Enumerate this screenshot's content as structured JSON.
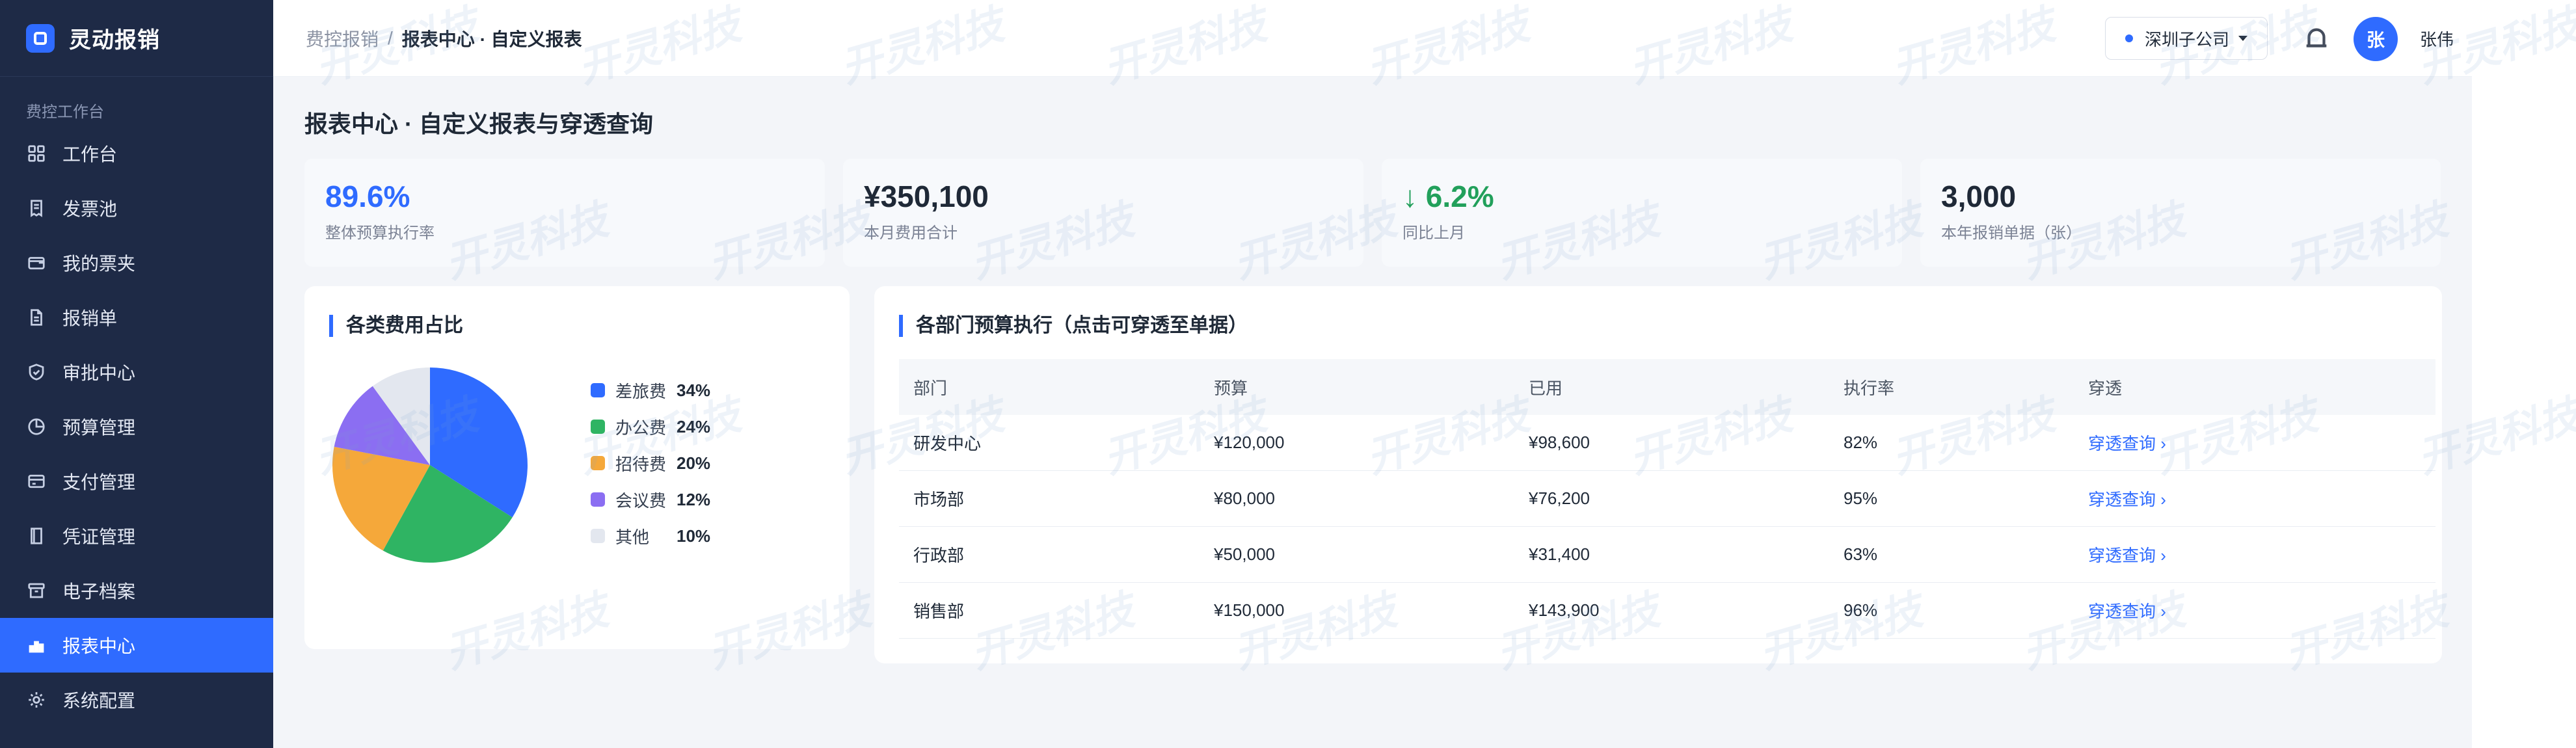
{
  "app": {
    "name": "灵动报销"
  },
  "sidebar": {
    "section_title": "费控工作台",
    "items": [
      {
        "label": "工作台",
        "icon": "grid-icon"
      },
      {
        "label": "发票池",
        "icon": "receipt-icon"
      },
      {
        "label": "我的票夹",
        "icon": "wallet-icon"
      },
      {
        "label": "报销单",
        "icon": "document-icon"
      },
      {
        "label": "审批中心",
        "icon": "shield-check-icon"
      },
      {
        "label": "预算管理",
        "icon": "pie-clock-icon"
      },
      {
        "label": "支付管理",
        "icon": "card-icon"
      },
      {
        "label": "凭证管理",
        "icon": "book-icon"
      },
      {
        "label": "电子档案",
        "icon": "archive-icon"
      },
      {
        "label": "报表中心",
        "icon": "bar-chart-icon",
        "active": true
      },
      {
        "label": "系统配置",
        "icon": "gear-icon"
      }
    ]
  },
  "header": {
    "breadcrumb_root": "费控报销",
    "breadcrumb_sep": "/",
    "breadcrumb_current": "报表中心 · 自定义报表",
    "company": "深圳子公司",
    "avatar_text": "张",
    "user_name": "张伟"
  },
  "page": {
    "title": "报表中心 · 自定义报表与穿透查询"
  },
  "stats": [
    {
      "value": "89.6%",
      "label": "整体预算执行率"
    },
    {
      "value": "¥350,100",
      "label": "本月费用合计"
    },
    {
      "value": "↓ 6.2%",
      "label": "同比上月"
    },
    {
      "value": "3,000",
      "label": "本年报销单据（张）"
    }
  ],
  "pie_panel": {
    "title": "各类费用占比"
  },
  "chart_data": {
    "type": "pie",
    "categories": [
      "差旅费",
      "办公费",
      "招待费",
      "会议费",
      "其他"
    ],
    "values": [
      34,
      24,
      20,
      12,
      10
    ],
    "value_labels": [
      "34%",
      "24%",
      "20%",
      "12%",
      "10%"
    ],
    "colors": [
      "#2f6bff",
      "#2fb463",
      "#f5a83a",
      "#8b6ef2",
      "#e3e7ef"
    ]
  },
  "table_panel": {
    "title": "各部门预算执行（点击可穿透至单据）",
    "columns": [
      "部门",
      "预算",
      "已用",
      "执行率",
      "穿透"
    ],
    "rows": [
      {
        "dept": "研发中心",
        "budget": "¥120,000",
        "used": "¥98,600",
        "rate": "82%",
        "link": "穿透查询 ›"
      },
      {
        "dept": "市场部",
        "budget": "¥80,000",
        "used": "¥76,200",
        "rate": "95%",
        "link": "穿透查询 ›"
      },
      {
        "dept": "行政部",
        "budget": "¥50,000",
        "used": "¥31,400",
        "rate": "63%",
        "link": "穿透查询 ›"
      },
      {
        "dept": "销售部",
        "budget": "¥150,000",
        "used": "¥143,900",
        "rate": "96%",
        "link": "穿透查询 ›"
      }
    ]
  },
  "watermark": {
    "text": "开灵科技"
  }
}
